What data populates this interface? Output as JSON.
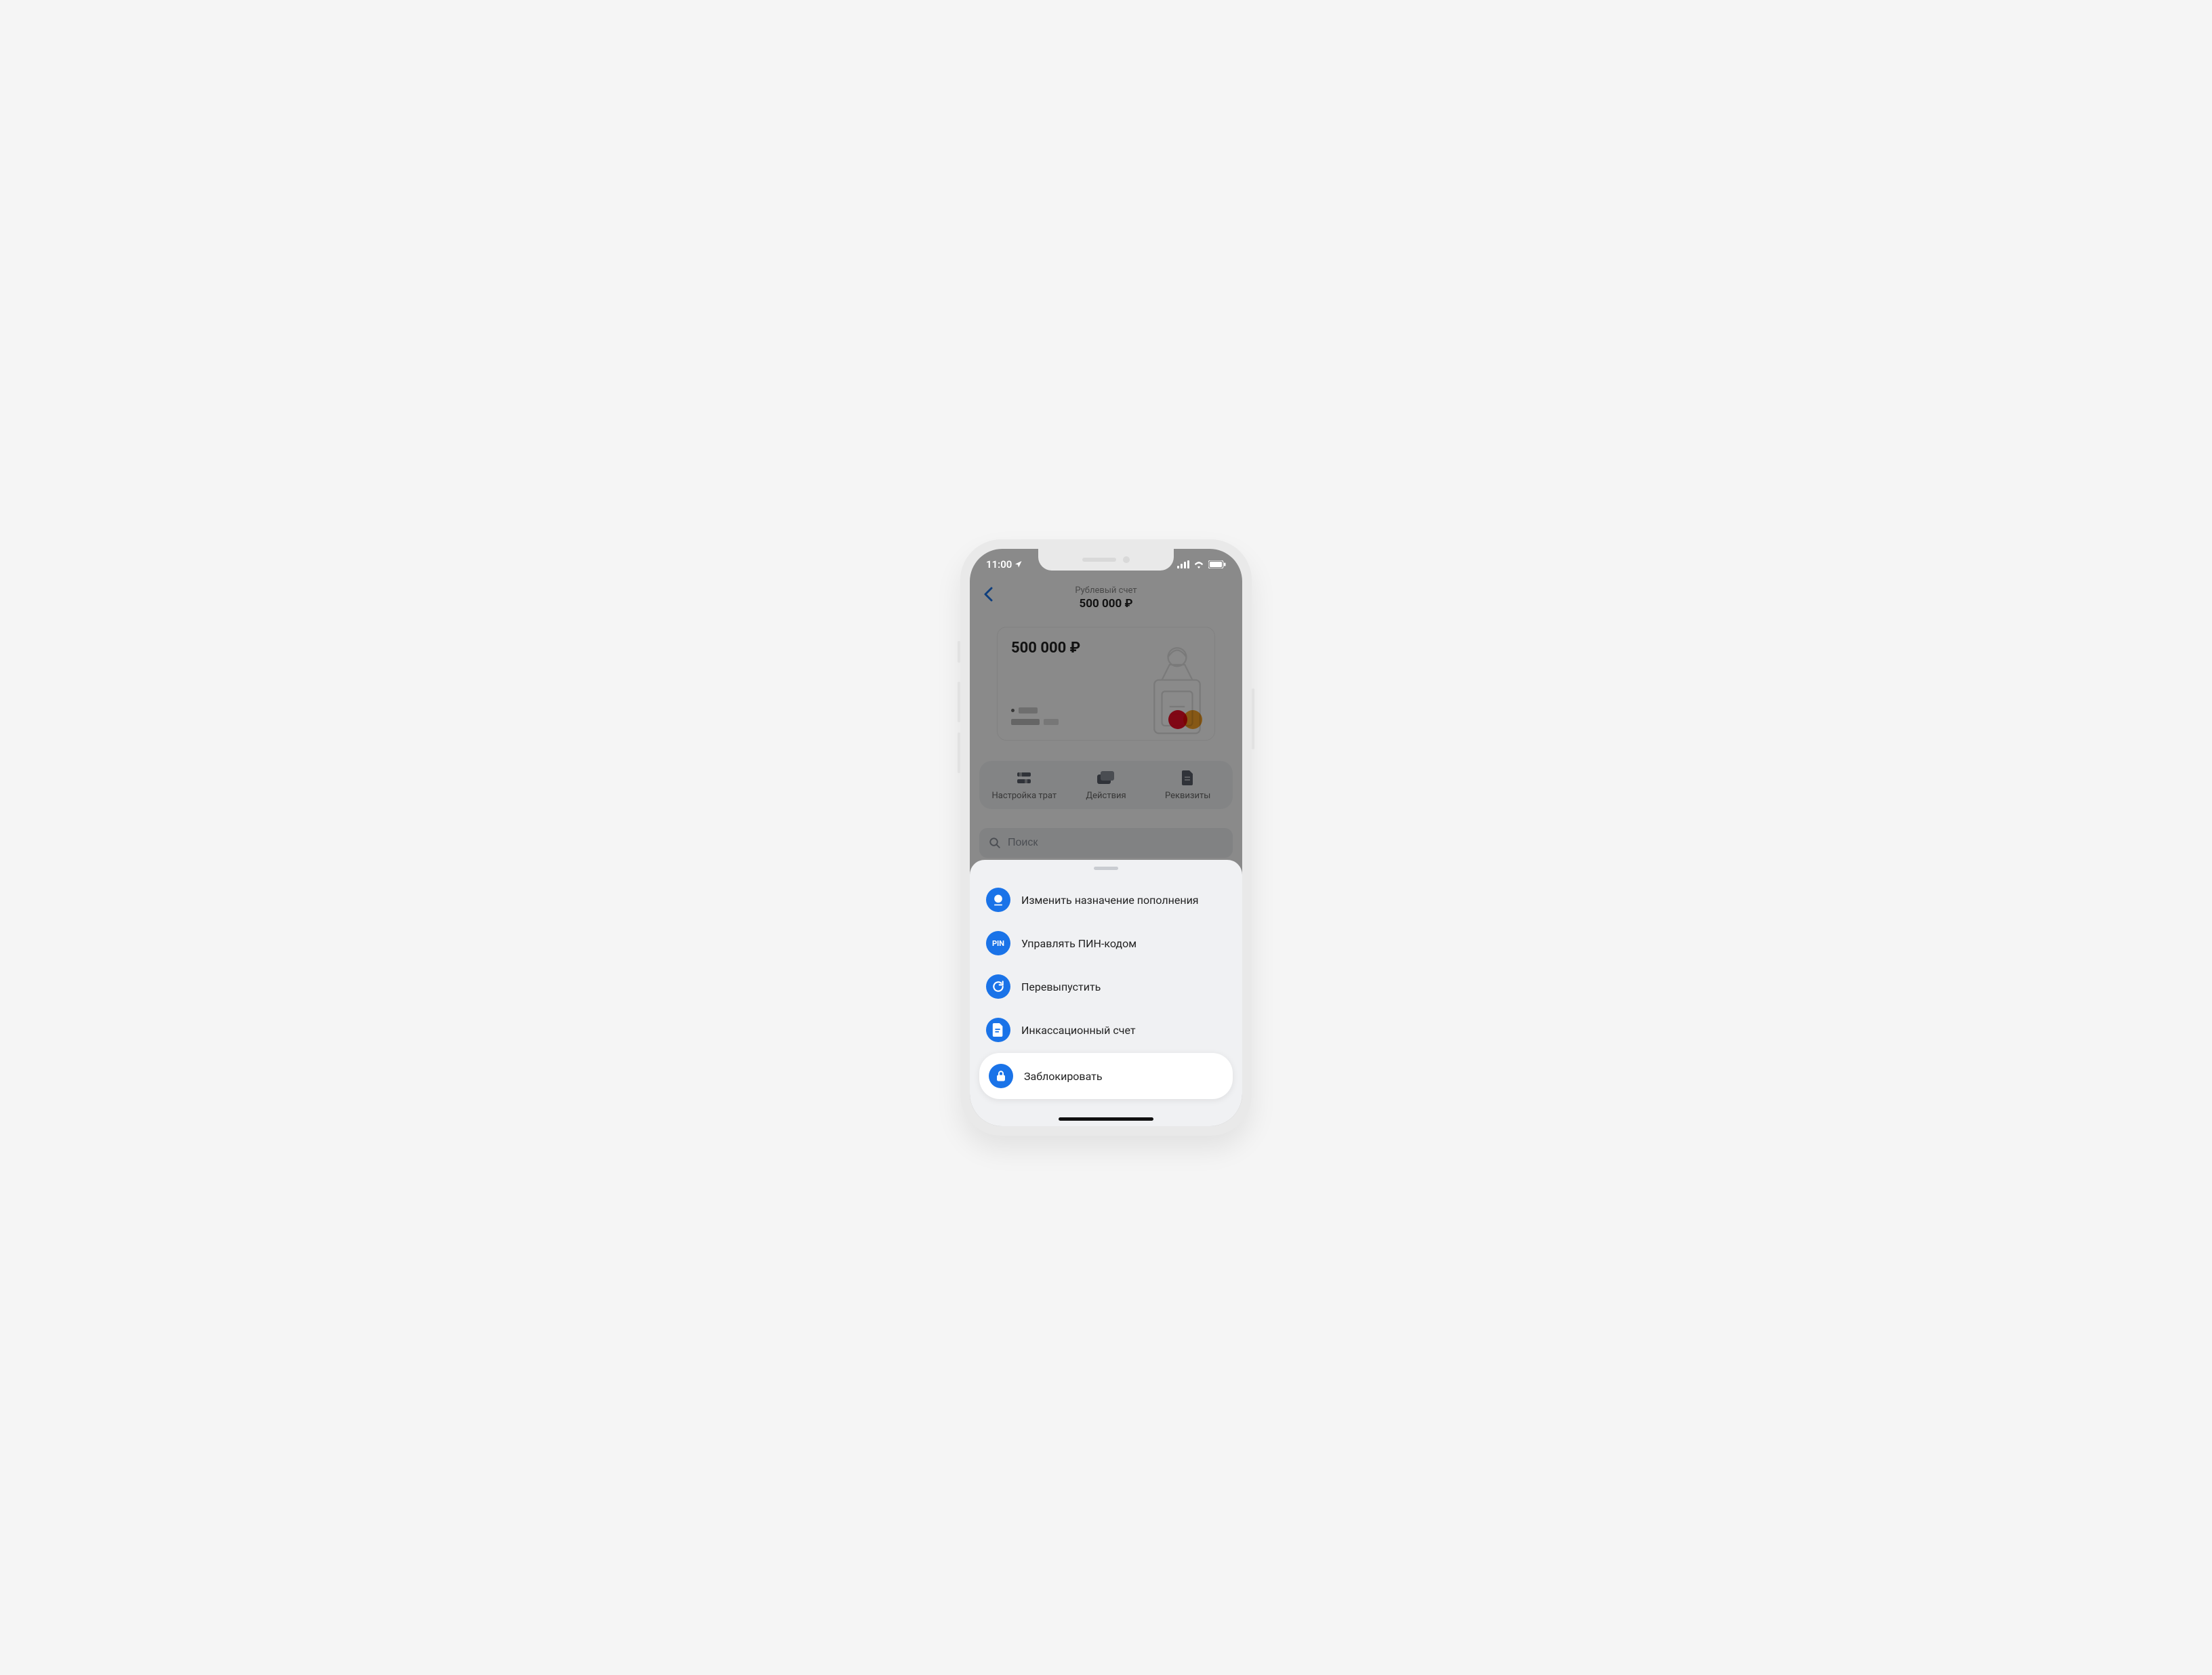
{
  "status": {
    "time": "11:00"
  },
  "header": {
    "subtitle": "Рублевый счет",
    "balance": "500 000 ₽"
  },
  "card": {
    "amount": "500 000 ₽"
  },
  "pills": {
    "spending": "Настройка трат",
    "actions": "Действия",
    "details": "Реквизиты"
  },
  "search": {
    "placeholder": "Поиск"
  },
  "sheet": {
    "items": [
      {
        "label": "Изменить назначение пополнения"
      },
      {
        "label": "Управлять ПИН-кодом"
      },
      {
        "label": "Перевыпустить"
      },
      {
        "label": "Инкассационный счет"
      },
      {
        "label": "Заблокировать"
      }
    ],
    "pin_abbrev": "PIN"
  },
  "colors": {
    "accent": "#1a73e8"
  }
}
